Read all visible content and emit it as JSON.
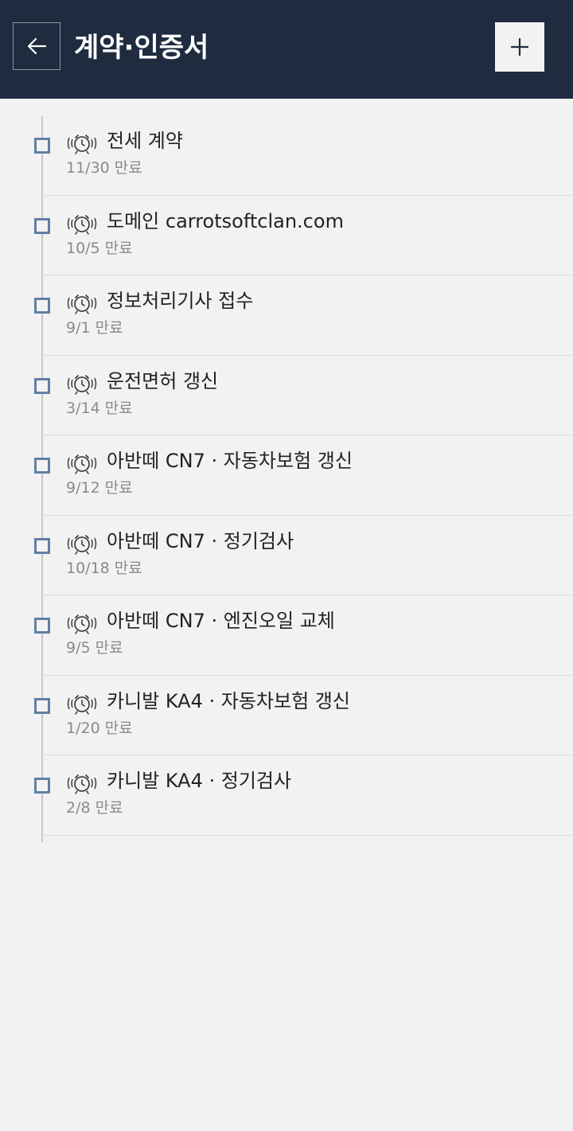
{
  "header": {
    "title": "계약·인증서",
    "back_icon": "arrow-left-icon",
    "add_icon": "plus-icon"
  },
  "colors": {
    "header_bg": "#1f2c40",
    "checkbox": "#5f7fa6",
    "background": "#f2f2f2"
  },
  "items": [
    {
      "title": "전세 계약",
      "subtitle": "11/30 만료"
    },
    {
      "title": "도메인 carrotsoftclan.com",
      "subtitle": "10/5 만료"
    },
    {
      "title": "정보처리기사 접수",
      "subtitle": "9/1 만료"
    },
    {
      "title": "운전면허 갱신",
      "subtitle": "3/14 만료"
    },
    {
      "title": "아반떼 CN7 · 자동차보험 갱신",
      "subtitle": "9/12 만료"
    },
    {
      "title": "아반떼 CN7 · 정기검사",
      "subtitle": "10/18 만료"
    },
    {
      "title": "아반떼 CN7 · 엔진오일 교체",
      "subtitle": "9/5 만료"
    },
    {
      "title": "카니발 KA4 · 자동차보험 갱신",
      "subtitle": "1/20 만료"
    },
    {
      "title": "카니발 KA4 · 정기검사",
      "subtitle": "2/8 만료"
    }
  ]
}
